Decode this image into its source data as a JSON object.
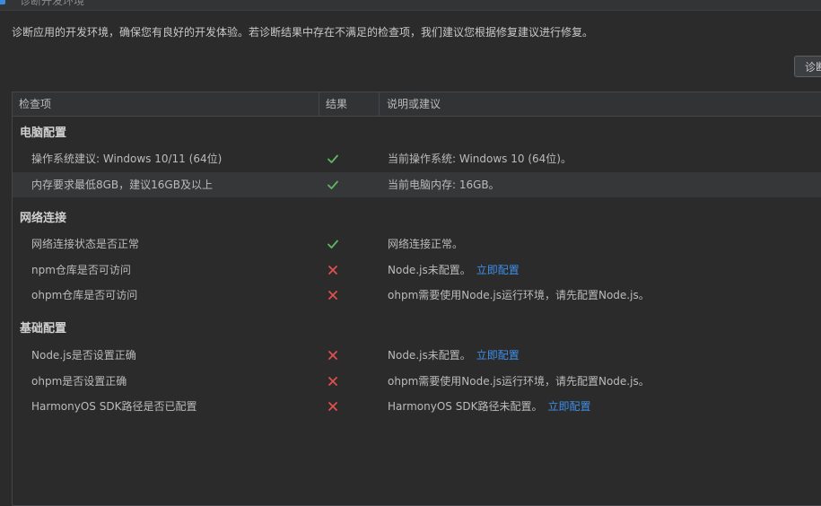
{
  "window": {
    "title": "诊断开发环境"
  },
  "description": "诊断应用的开发环境，确保您有良好的开发体验。若诊断结果中存在不满足的检查项，我们建议您根据修复建议进行修复。",
  "diagnose_button": "诊断",
  "table": {
    "columns": [
      "检查项",
      "结果",
      "说明或建议"
    ],
    "groups": [
      {
        "name": "电脑配置",
        "rows": [
          {
            "item": "操作系统建议: Windows 10/11 (64位)",
            "result": "pass",
            "desc": "当前操作系统: Windows 10 (64位)。",
            "link": ""
          },
          {
            "item": "内存要求最低8GB，建议16GB及以上",
            "result": "pass",
            "desc": "当前电脑内存: 16GB。",
            "link": ""
          }
        ]
      },
      {
        "name": "网络连接",
        "rows": [
          {
            "item": "网络连接状态是否正常",
            "result": "pass",
            "desc": "网络连接正常。",
            "link": ""
          },
          {
            "item": "npm仓库是否可访问",
            "result": "fail",
            "desc": "Node.js未配置。",
            "link": "立即配置"
          },
          {
            "item": "ohpm仓库是否可访问",
            "result": "fail",
            "desc": "ohpm需要使用Node.js运行环境，请先配置Node.js。",
            "link": ""
          }
        ]
      },
      {
        "name": "基础配置",
        "rows": [
          {
            "item": "Node.js是否设置正确",
            "result": "fail",
            "desc": "Node.js未配置。",
            "link": "立即配置"
          },
          {
            "item": "ohpm是否设置正确",
            "result": "fail",
            "desc": "ohpm需要使用Node.js运行环境，请先配置Node.js。",
            "link": ""
          },
          {
            "item": "HarmonyOS SDK路径是否已配置",
            "result": "fail",
            "desc": "HarmonyOS SDK路径未配置。",
            "link": "立即配置"
          }
        ]
      }
    ]
  },
  "colors": {
    "pass": "#5fb85f",
    "fail": "#e0504f",
    "link": "#3d8fe8",
    "background": "#2b2b2b"
  },
  "icons": {
    "pass": "check-icon",
    "fail": "cross-icon"
  }
}
